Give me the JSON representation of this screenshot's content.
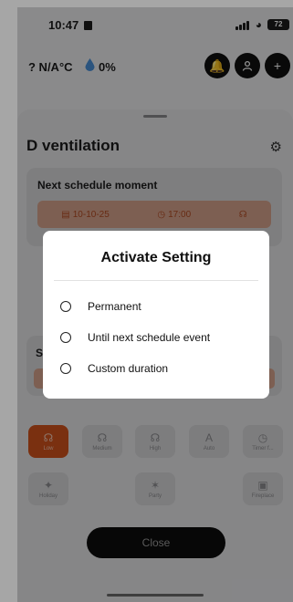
{
  "status_bar": {
    "time": "10:47",
    "battery": "72"
  },
  "header": {
    "temperature": "? N/A°C",
    "humidity": "0%"
  },
  "sheet": {
    "title": "D ventilation",
    "schedule_card": {
      "title": "Next schedule moment",
      "date": "10-10-25",
      "time": "17:00"
    },
    "second_card_letter": "S",
    "modes": [
      {
        "label": "Low",
        "icon": "fan-speed-1-icon",
        "active": true
      },
      {
        "label": "Medium",
        "icon": "fan-speed-2-icon",
        "active": false
      },
      {
        "label": "High",
        "icon": "fan-speed-3-icon",
        "active": false
      },
      {
        "label": "Auto",
        "icon": "fan-auto-icon",
        "active": false
      },
      {
        "label": "Timer f...",
        "icon": "timer-icon",
        "active": false
      },
      {
        "label": "Holiday",
        "icon": "holiday-icon",
        "active": false
      },
      {
        "label": "Party",
        "icon": "party-icon",
        "active": false
      },
      {
        "label": "Fireplace",
        "icon": "fireplace-icon",
        "active": false
      }
    ],
    "close_label": "Close"
  },
  "dialog": {
    "title": "Activate Setting",
    "options": [
      "Permanent",
      "Until next schedule event",
      "Custom duration"
    ]
  },
  "colors": {
    "accent": "#d2541e",
    "accent_soft": "#d7a48e",
    "dark_button": "#0d0d0d"
  }
}
